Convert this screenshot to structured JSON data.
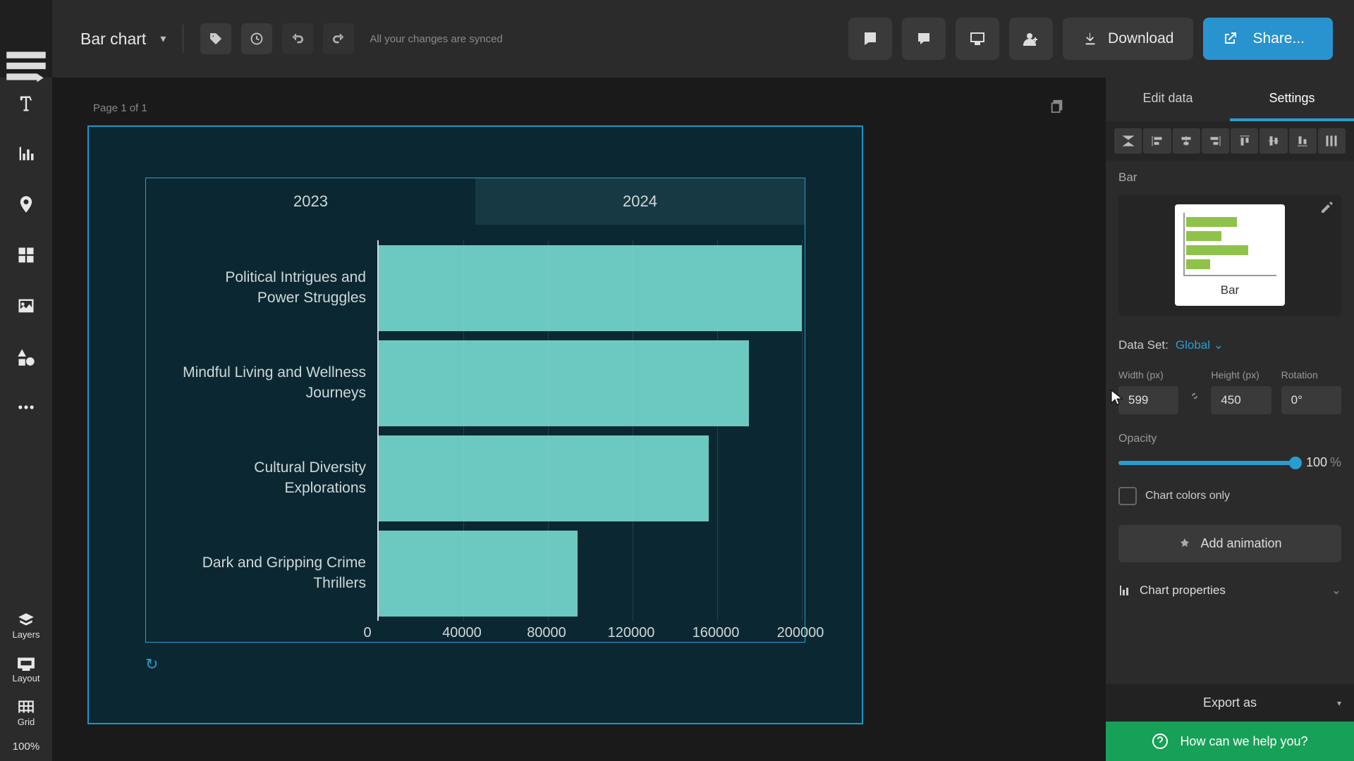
{
  "doc": {
    "title": "Bar chart",
    "sync_msg": "All your changes are synced"
  },
  "page": {
    "label": "Page 1 of 1"
  },
  "top_actions": {
    "download": "Download",
    "share": "Share..."
  },
  "tabs": {
    "y2023": "2023",
    "y2024": "2024"
  },
  "chart_data": {
    "type": "bar",
    "orientation": "horizontal",
    "active_tab": "2024",
    "categories": [
      "Political Intrigues and Power Struggles",
      "Mindful Living and Wellness Journeys",
      "Cultural Diversity Explorations",
      "Dark and Gripping Crime Thrillers"
    ],
    "values": [
      200000,
      175000,
      156000,
      94000
    ],
    "xlabel": "",
    "ylabel": "",
    "xlim": [
      0,
      200000
    ],
    "x_ticks": [
      0,
      40000,
      80000,
      120000,
      160000,
      200000
    ],
    "x_tick_labels": [
      "0",
      "40000",
      "80000",
      "120000",
      "160000",
      "200000"
    ],
    "bar_color": "#6cc9c1"
  },
  "right": {
    "tab_edit": "Edit data",
    "tab_settings": "Settings",
    "section_bar": "Bar",
    "thumb_label": "Bar",
    "dataset_label": "Data Set:",
    "dataset_value": "Global",
    "width_label": "Width (px)",
    "width_val": "599",
    "height_label": "Height (px)",
    "height_val": "450",
    "rotation_label": "Rotation",
    "rotation_val": "0°",
    "opacity_label": "Opacity",
    "opacity_val": "100",
    "opacity_pct": "%",
    "colors_only": "Chart colors only",
    "add_anim": "Add animation",
    "chart_props": "Chart properties",
    "export": "Export as",
    "help": "How can we help you?"
  },
  "rail": {
    "layers": "Layers",
    "layout": "Layout",
    "grid": "Grid",
    "zoom": "100%"
  }
}
